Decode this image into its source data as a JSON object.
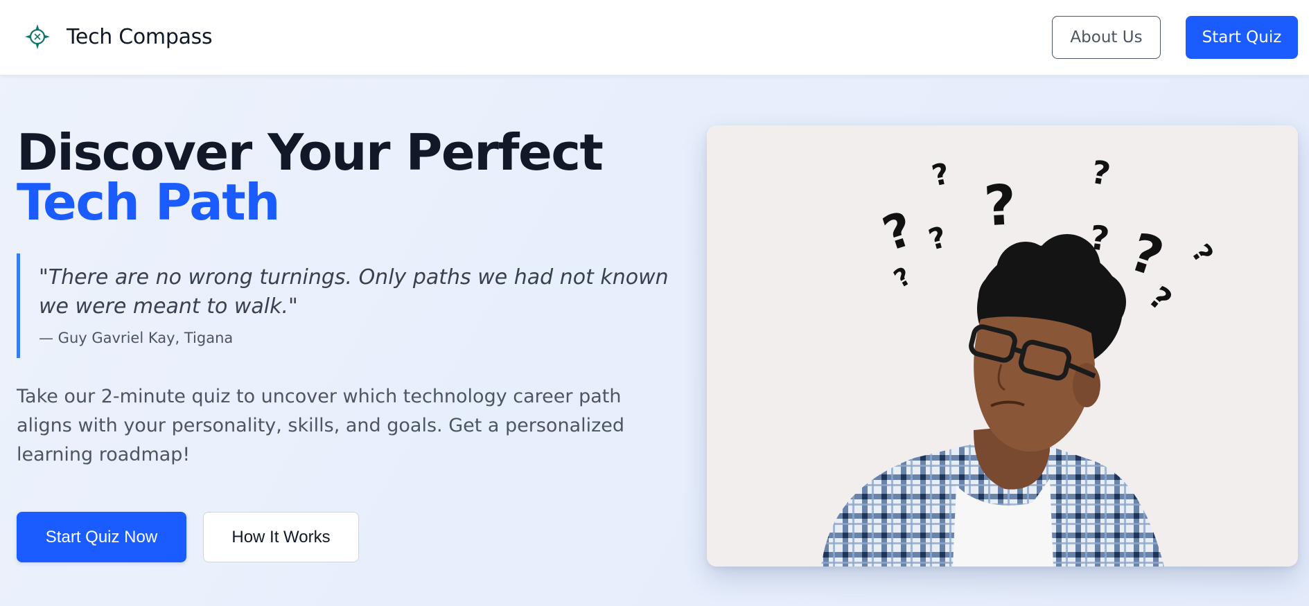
{
  "header": {
    "brand_name": "Tech Compass",
    "brand_icon": "compass-icon",
    "about_label": "About Us",
    "start_quiz_label": "Start Quiz"
  },
  "hero": {
    "title_line1": "Discover Your Perfect",
    "title_line2": "Tech Path",
    "quote": "\"There are no wrong turnings. Only paths we had not known we were meant to walk.\"",
    "quote_author": "— Guy Gavriel Kay, Tigana",
    "description": "Take our 2-minute quiz to uncover which technology career path aligns with your personality, skills, and goals. Get a personalized learning roadmap!",
    "primary_cta": "Start Quiz Now",
    "secondary_cta": "How It Works"
  },
  "colors": {
    "accent": "#1a5cff",
    "quote_border": "#3b7bf2",
    "heading": "#111827",
    "body_text": "#4b5563",
    "image_background": "#f3eeee"
  }
}
